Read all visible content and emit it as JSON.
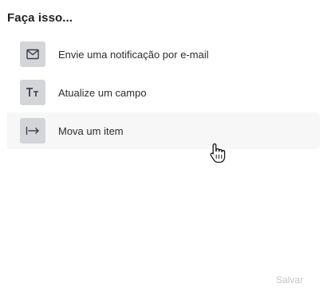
{
  "heading": "Faça isso...",
  "actions": [
    {
      "label": "Envie uma notificação por e-mail",
      "icon": "mail-icon"
    },
    {
      "label": "Atualize um campo",
      "icon": "text-format-icon",
      "glyph": "Tт"
    },
    {
      "label": "Mova um item",
      "icon": "move-arrow-icon"
    }
  ],
  "hovered_action": "Mova um item",
  "save_label": "Salvar",
  "colors": {
    "icon_bg": "#d3d5d9",
    "hover_bg": "#f7f7f8",
    "text": "#2b2d31",
    "disabled_text": "#c1c4c9"
  }
}
